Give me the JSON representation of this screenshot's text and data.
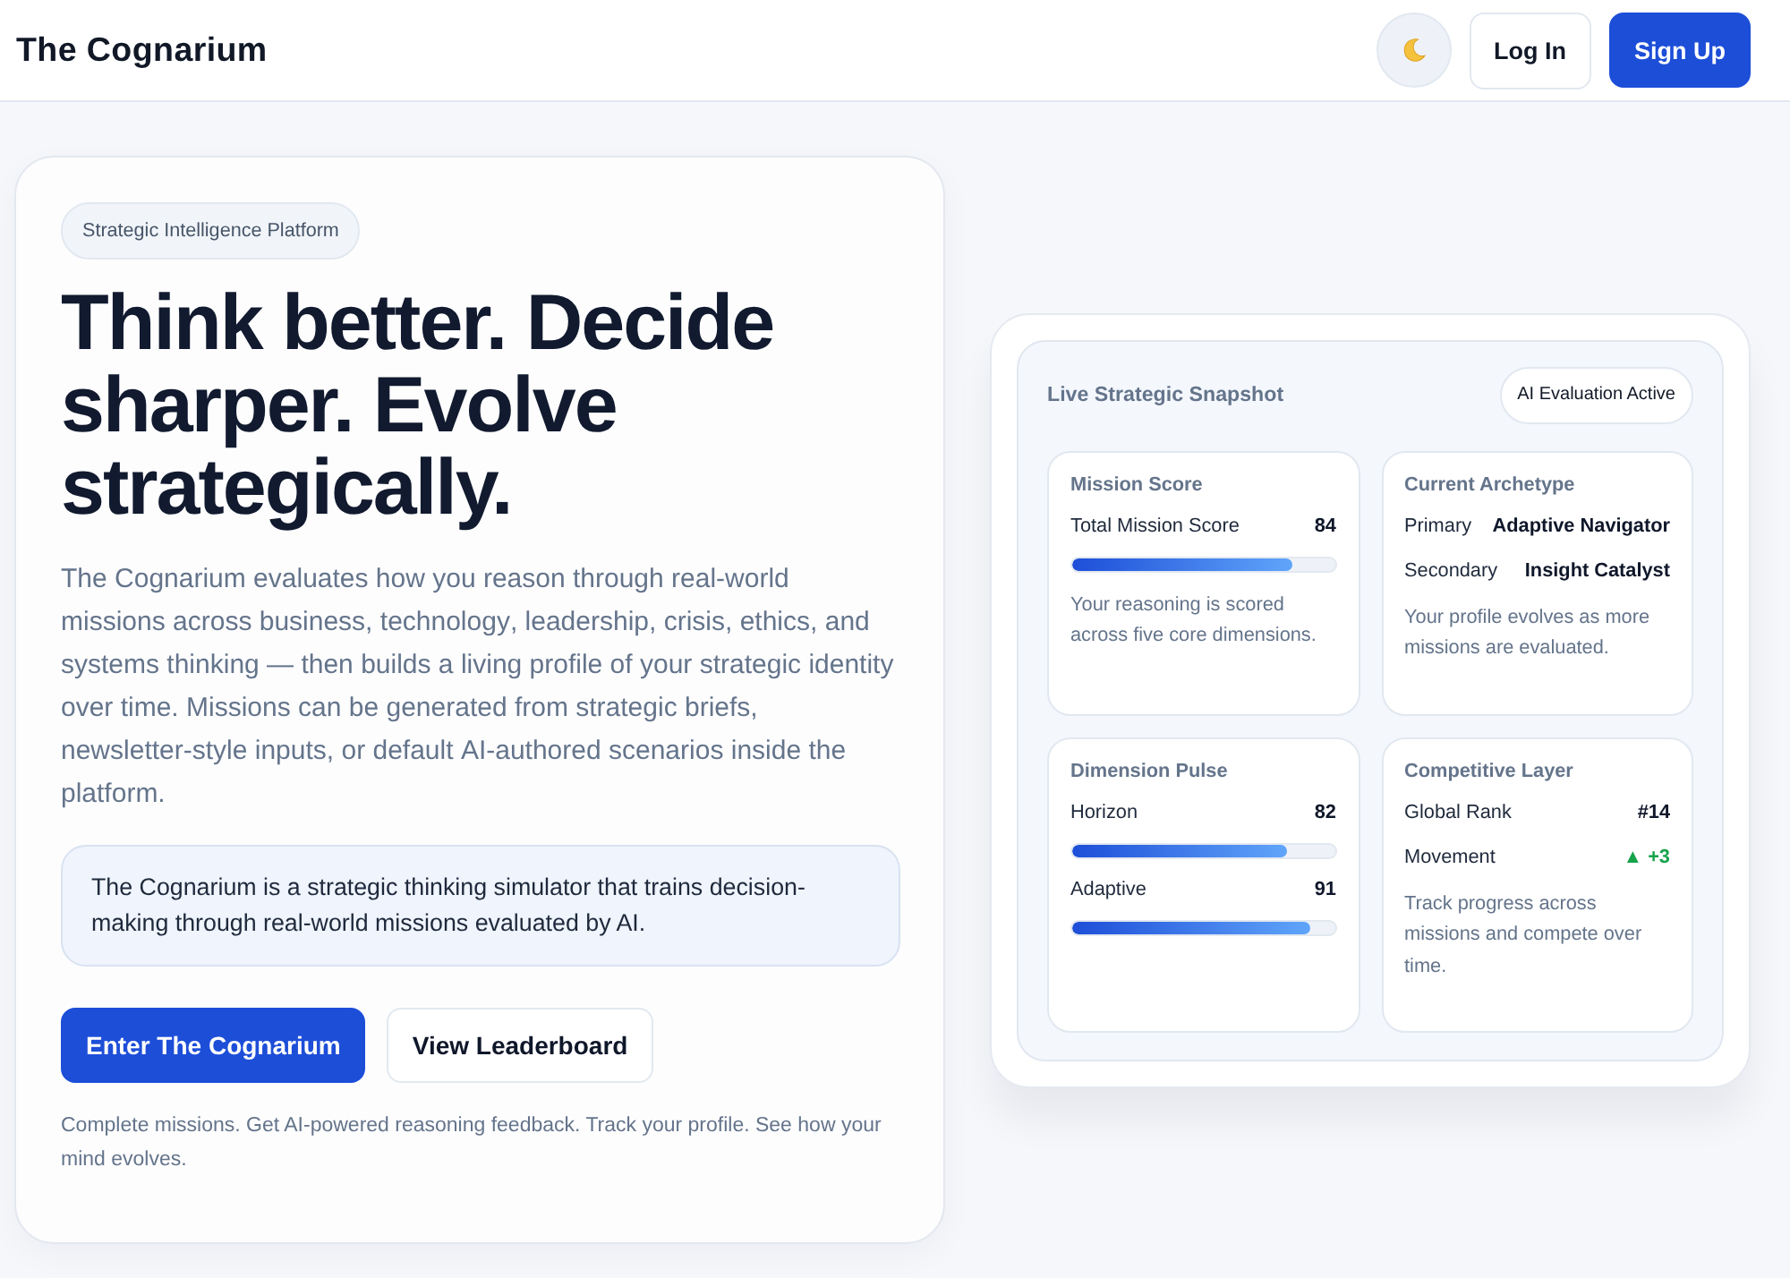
{
  "header": {
    "brand": "The Cognarium",
    "nav_buttons": [
      {
        "label": "Log In",
        "primary": false
      },
      {
        "label": "Sign Up",
        "primary": true
      }
    ]
  },
  "hero": {
    "badge": "Strategic Intelligence Platform",
    "headline": "Think better. Decide sharper. Evolve strategically.",
    "description": "The Cognarium evaluates how you reason through real-world missions across business, technology, leadership, crisis, ethics, and systems thinking — then builds a living profile of your strategic identity over time. Missions can be generated from strategic briefs, newsletter-style inputs, or default AI-authored scenarios inside the platform.",
    "callout": "The Cognarium is a strategic thinking simulator that trains decision-making through real-world missions evaluated by AI.",
    "buttons": [
      {
        "label": "Enter The Cognarium",
        "primary": true
      },
      {
        "label": "View Leaderboard",
        "primary": false
      }
    ],
    "footnote": "Complete missions. Get AI-powered reasoning feedback. Track your profile. See how your mind evolves."
  },
  "snapshot": {
    "title": "Live Strategic Snapshot",
    "status_badge": "AI Evaluation Active",
    "tiles": [
      {
        "title": "Mission Score",
        "rows": [
          {
            "kind": "meter",
            "label": "Total Mission Score",
            "value": "84",
            "level": 0.84
          }
        ],
        "note": "Your reasoning is scored across five core dimensions."
      },
      {
        "title": "Current Archetype",
        "rows": [
          {
            "kind": "pair",
            "label": "Primary",
            "value": "Adaptive Navigator"
          },
          {
            "kind": "pair",
            "label": "Secondary",
            "value": "Insight Catalyst"
          }
        ],
        "note": "Your profile evolves as more missions are evaluated."
      },
      {
        "title": "Dimension Pulse",
        "rows": [
          {
            "kind": "meter",
            "label": "Horizon",
            "value": "82",
            "level": 0.82
          },
          {
            "kind": "meter",
            "label": "Adaptive",
            "value": "91",
            "level": 0.91
          }
        ]
      },
      {
        "title": "Competitive Layer",
        "rows": [
          {
            "kind": "pair",
            "label": "Global Rank",
            "value": "#14"
          },
          {
            "kind": "trend",
            "label": "Movement",
            "value": "▲ +3"
          }
        ],
        "note": "Track progress across missions and compete over time."
      }
    ]
  }
}
